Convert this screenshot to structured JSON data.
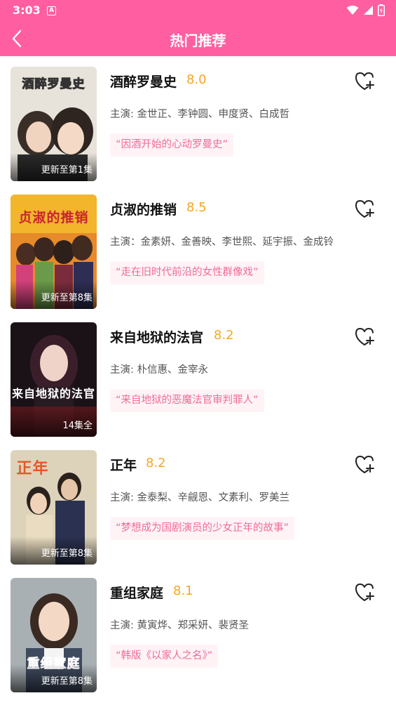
{
  "status_bar": {
    "time": "3:03",
    "notification_glyph": "A"
  },
  "header": {
    "title": "热门推荐",
    "back_icon": "chevron-left-icon"
  },
  "colors": {
    "brand": "#ff5fa0",
    "rating": "#f6a723",
    "tag_text": "#f06b99",
    "tag_bg": "#fff3f6"
  },
  "items": [
    {
      "title": "酒醉罗曼史",
      "rating": "8.0",
      "cast": "主演: 金世正、李钟圆、申度贤、白成哲",
      "tagline": "“因酒开始的心动罗曼史”",
      "badge": "更新至第1集",
      "poster_text": "酒醉罗曼史"
    },
    {
      "title": "贞淑的推销",
      "rating": "8.5",
      "cast": "主演：金素妍、金善映、李世熙、延宇振、金成铃",
      "tagline": "“走在旧时代前沿的女性群像戏”",
      "badge": "更新至第8集",
      "poster_text": "贞淑的推销"
    },
    {
      "title": "来自地狱的法官",
      "rating": "8.2",
      "cast": "主演: 朴信惠、金宰永",
      "tagline": "“来自地狱的恶魔法官审判罪人”",
      "badge": "14集全",
      "poster_text": "来自地狱的法官"
    },
    {
      "title": "正年",
      "rating": "8.2",
      "cast": "主演: 金泰梨、辛觎恩、文素利、罗美兰",
      "tagline": "“梦想成为国剧演员的少女正年的故事”",
      "badge": "更新至第8集",
      "poster_text": "正年"
    },
    {
      "title": "重组家庭",
      "rating": "8.1",
      "cast": "主演: 黄寅烨、郑采妍、裴贤圣",
      "tagline": "“韩版《以家人之名》”",
      "badge": "更新至第8集",
      "poster_text": "重组家庭"
    }
  ]
}
